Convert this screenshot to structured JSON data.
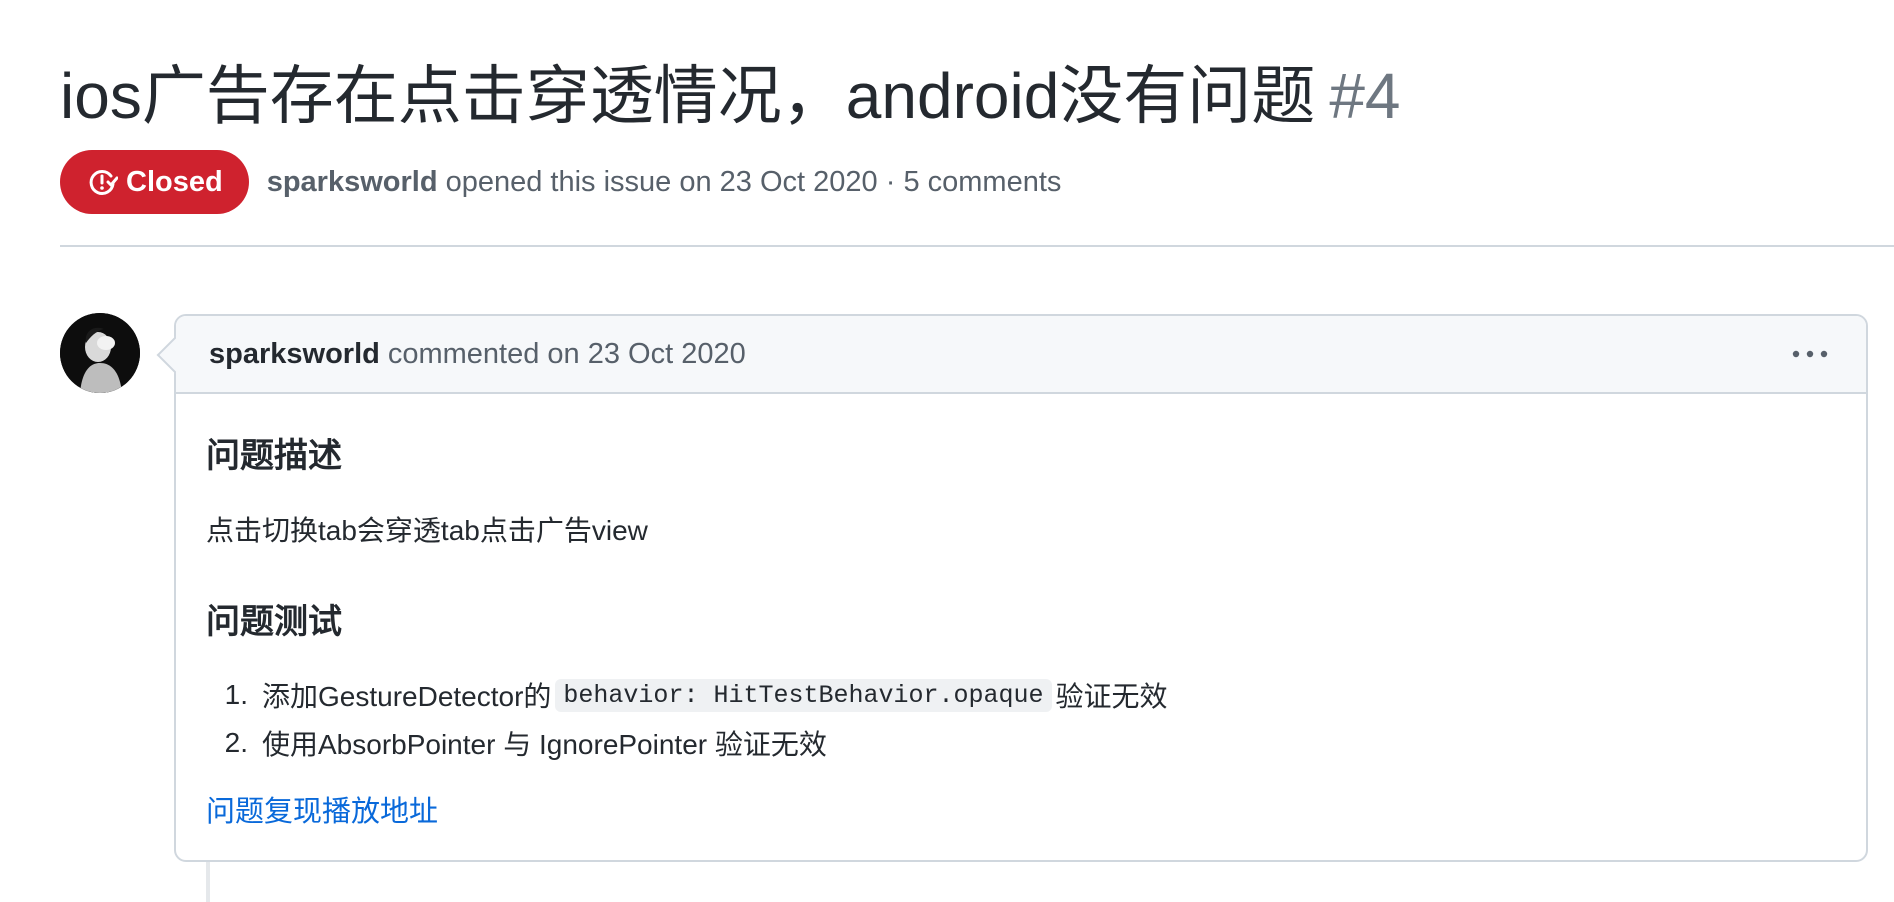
{
  "issue": {
    "title": "ios广告存在点击穿透情况，android没有问题",
    "number": "#4",
    "state": "Closed",
    "author": "sparksworld",
    "opened_text": "opened this issue on 23 Oct 2020 · 5 comments"
  },
  "comment": {
    "author": "sparksworld",
    "action": "commented on 23 Oct 2020",
    "heading_1": "问题描述",
    "paragraph": "点击切换tab会穿透tab点击广告view",
    "heading_2": "问题测试",
    "steps": [
      {
        "num": "1.",
        "before": "添加GestureDetector的",
        "code": "behavior: HitTestBehavior.opaque",
        "after": "验证无效"
      },
      {
        "num": "2.",
        "before": "使用AbsorbPointer 与 IgnorePointer 验证无效",
        "code": "",
        "after": ""
      }
    ],
    "link_text": "问题复现播放地址"
  },
  "colors": {
    "closed_red": "#cf222e",
    "link_blue": "#0969da",
    "muted_text": "#57606a"
  },
  "icons": {
    "state": "issue-closed-icon",
    "more": "kebab-horizontal-icon"
  }
}
